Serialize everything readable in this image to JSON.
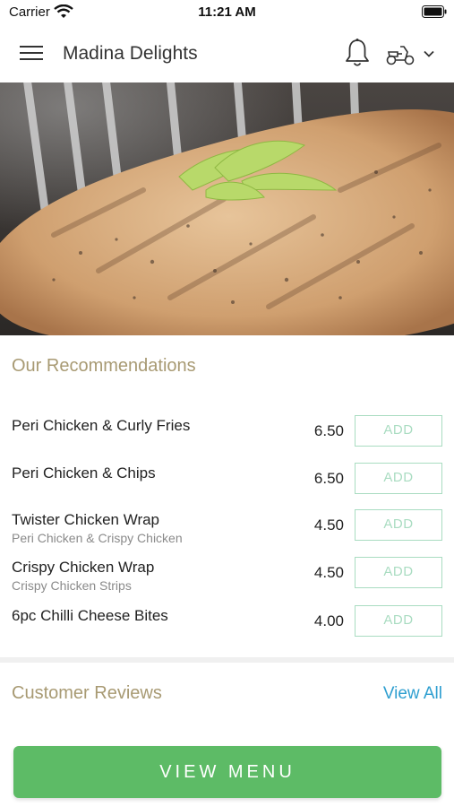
{
  "status_bar": {
    "carrier": "Carrier",
    "time": "11:21 AM"
  },
  "nav": {
    "title": "Madina Delights",
    "icons": [
      "hamburger-menu-icon",
      "bell-icon",
      "scooter-icon",
      "chevron-down-icon"
    ]
  },
  "recommendations": {
    "title": "Our Recommendations",
    "add_label": "ADD",
    "items": [
      {
        "name": "Peri Chicken & Curly Fries",
        "subtitle": "",
        "price": "6.50"
      },
      {
        "name": "Peri Chicken & Chips",
        "subtitle": "",
        "price": "6.50"
      },
      {
        "name": "Twister Chicken Wrap",
        "subtitle": "Peri Chicken & Crispy Chicken",
        "price": "4.50"
      },
      {
        "name": "Crispy Chicken Wrap",
        "subtitle": "Crispy Chicken Strips",
        "price": "4.50"
      },
      {
        "name": "6pc Chilli Cheese Bites",
        "subtitle": "",
        "price": "4.00"
      }
    ]
  },
  "reviews": {
    "title": "Customer Reviews",
    "view_all_label": "View All"
  },
  "footer": {
    "view_menu_label": "VIEW MENU"
  },
  "colors": {
    "section_title": "#a89a73",
    "add_button": "#a9dcc1",
    "link": "#2f9fd0",
    "primary_button": "#5dbb66"
  }
}
